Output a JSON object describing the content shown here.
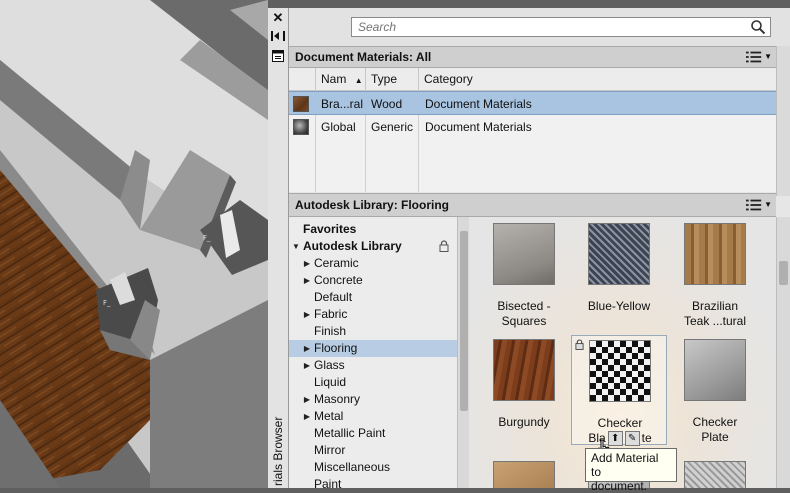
{
  "palette": {
    "title": "rials Browser",
    "close_label": "✕",
    "search": {
      "placeholder": "Search"
    },
    "document_section": {
      "title": "Document Materials: All",
      "columns": [
        "Nam",
        "Type",
        "Category"
      ],
      "sort_indicator": "▲",
      "rows": [
        {
          "name": "Bra...ral",
          "type": "Wood",
          "category": "Document Materials",
          "selected": true
        },
        {
          "name": "Global",
          "type": "Generic",
          "category": "Document Materials",
          "selected": false
        }
      ]
    },
    "library_section": {
      "title": "Autodesk Library: Flooring",
      "tree": [
        {
          "label": "Favorites",
          "bold": true,
          "arrow": ""
        },
        {
          "label": "Autodesk Library",
          "bold": true,
          "arrow": "down",
          "lock": true
        },
        {
          "label": "Ceramic",
          "arrow": "right"
        },
        {
          "label": "Concrete",
          "arrow": "right"
        },
        {
          "label": "Default",
          "arrow": ""
        },
        {
          "label": "Fabric",
          "arrow": "right"
        },
        {
          "label": "Finish",
          "arrow": ""
        },
        {
          "label": "Flooring",
          "arrow": "right",
          "selected": true
        },
        {
          "label": "Glass",
          "arrow": "right"
        },
        {
          "label": "Liquid",
          "arrow": ""
        },
        {
          "label": "Masonry",
          "arrow": "right"
        },
        {
          "label": "Metal",
          "arrow": "right"
        },
        {
          "label": "Metallic Paint",
          "arrow": ""
        },
        {
          "label": "Mirror",
          "arrow": ""
        },
        {
          "label": "Miscellaneous",
          "arrow": ""
        },
        {
          "label": "Paint",
          "arrow": ""
        }
      ],
      "materials": [
        {
          "label1": "Bisected -",
          "label2": "Squares",
          "texture": "gray-stone"
        },
        {
          "label1": "Blue-Yellow",
          "label2": "",
          "texture": "blue-weave"
        },
        {
          "label1": "Brazilian",
          "label2": "Teak ...tural",
          "texture": "teak"
        },
        {
          "label1": "Burgundy",
          "label2": "",
          "texture": "burgundy-wood"
        },
        {
          "label1": "Checker",
          "label2": "Bla",
          "label2_tail": "te",
          "texture": "checker",
          "hover": true
        },
        {
          "label1": "Checker",
          "label2": "Plate",
          "texture": "steel-plate"
        }
      ]
    },
    "tooltip": {
      "line1": "Add Material to",
      "line2": "document."
    }
  }
}
